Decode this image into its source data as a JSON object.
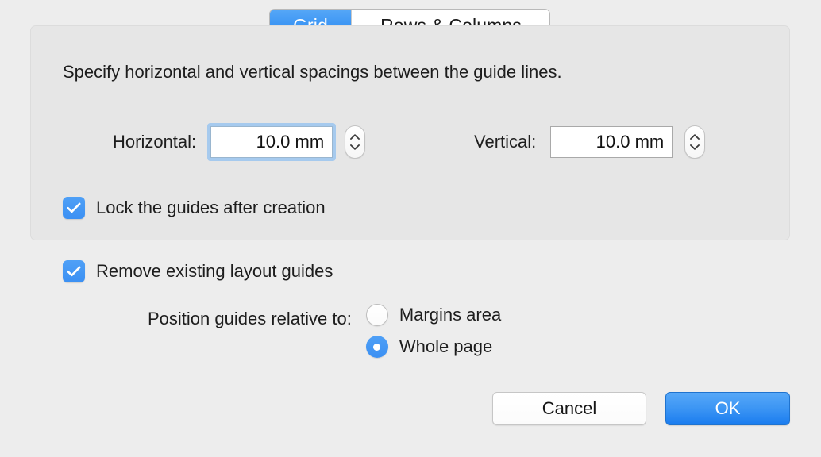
{
  "tabs": [
    {
      "label": "Grid",
      "selected": true
    },
    {
      "label": "Rows & Columns",
      "selected": false
    }
  ],
  "grid_panel": {
    "description": "Specify horizontal and vertical spacings between the guide lines.",
    "horizontal": {
      "label": "Horizontal:",
      "value": "10.0 mm",
      "focused": true
    },
    "vertical": {
      "label": "Vertical:",
      "value": "10.0 mm",
      "focused": false
    },
    "lock_guides": {
      "label": "Lock the guides after creation",
      "checked": true
    }
  },
  "options": {
    "remove_guides": {
      "label": "Remove existing layout guides",
      "checked": true
    },
    "position_prompt": "Position guides relative to:",
    "position_options": [
      {
        "label": "Margins area",
        "selected": false
      },
      {
        "label": "Whole page",
        "selected": true
      }
    ]
  },
  "buttons": {
    "cancel": "Cancel",
    "ok": "OK"
  },
  "colors": {
    "accent_blue": "#3b90f3",
    "focus_ring": "#a6caee",
    "window_bg": "#ededed",
    "group_bg": "#e6e6e6"
  },
  "icons": {
    "stepper_up": "chevron-up-icon",
    "stepper_down": "chevron-down-icon",
    "checkmark": "checkmark-icon"
  }
}
